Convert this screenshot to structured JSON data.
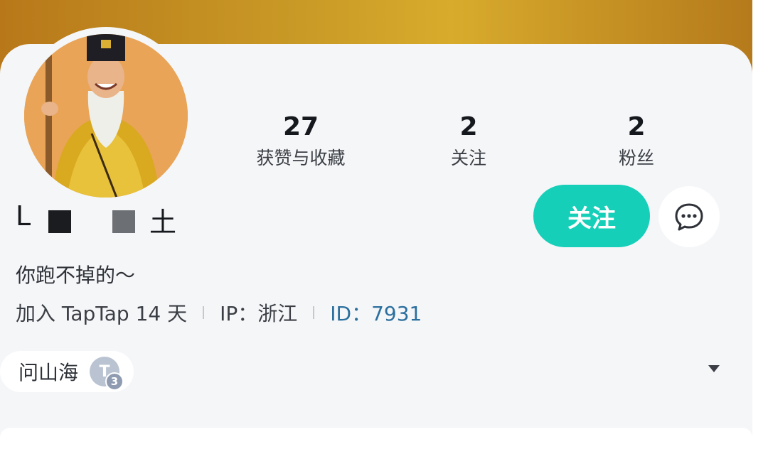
{
  "stats": [
    {
      "value": "27",
      "label": "获赞与收藏"
    },
    {
      "value": "2",
      "label": "关注"
    },
    {
      "value": "2",
      "label": "粉丝"
    }
  ],
  "profile": {
    "name_first": "L",
    "name_last": "土",
    "bio": "你跑不掉的～",
    "joined": "加入 TapTap 14 天",
    "ip": "IP：浙江",
    "id": "ID：7931"
  },
  "actions": {
    "follow_label": "关注"
  },
  "tag": {
    "label": "问山海",
    "level_letter": "T",
    "level_number": "3"
  },
  "colors": {
    "accent": "#16cfb9",
    "id_link": "#2b6f9e",
    "banner": "#c99a26"
  },
  "icons": {
    "message": "chat-bubble-dots-icon",
    "dropdown": "caret-down-icon"
  }
}
